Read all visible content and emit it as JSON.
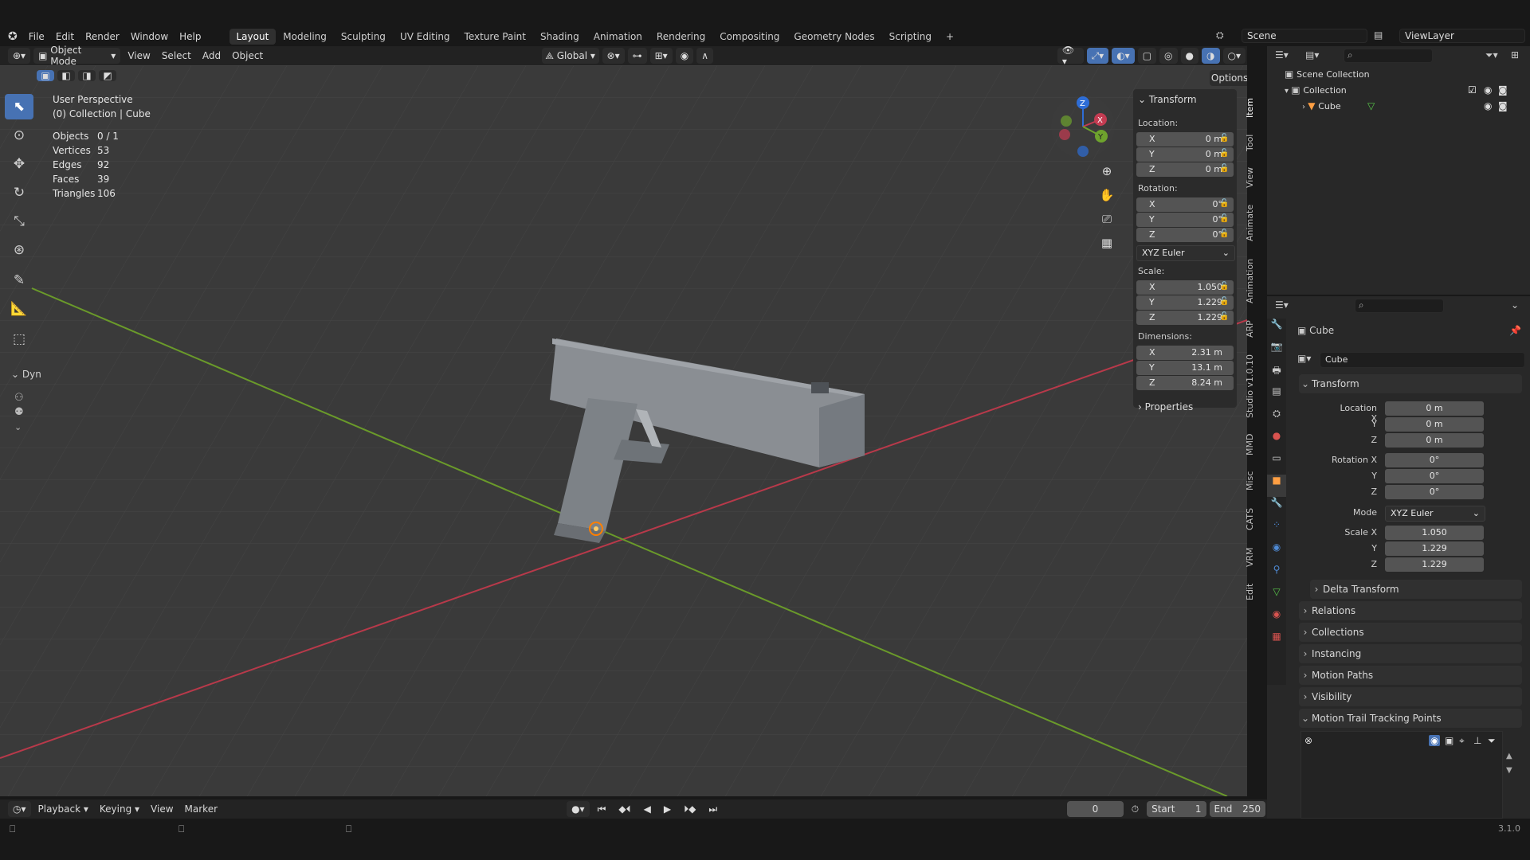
{
  "menus": {
    "file": "File",
    "edit": "Edit",
    "render": "Render",
    "window": "Window",
    "help": "Help"
  },
  "workspaces": [
    "Layout",
    "Modeling",
    "Sculpting",
    "UV Editing",
    "Texture Paint",
    "Shading",
    "Animation",
    "Rendering",
    "Compositing",
    "Geometry Nodes",
    "Scripting"
  ],
  "workspace_add": "+",
  "scene_name": "Scene",
  "view_layer": "ViewLayer",
  "viewport_header": {
    "mode": "Object Mode",
    "view": "View",
    "select": "Select",
    "add": "Add",
    "object": "Object",
    "orientation": "Global",
    "options": "Options"
  },
  "overlay": {
    "perspective": "User Perspective",
    "collection_line": "(0) Collection | Cube",
    "stats": [
      {
        "label": "Objects",
        "value": "0 / 1"
      },
      {
        "label": "Vertices",
        "value": "53"
      },
      {
        "label": "Edges",
        "value": "92"
      },
      {
        "label": "Faces",
        "value": "39"
      },
      {
        "label": "Triangles",
        "value": "106"
      }
    ],
    "dyn": "Dyn"
  },
  "npanel": {
    "title": "Transform",
    "location_label": "Location:",
    "location": [
      {
        "axis": "X",
        "value": "0 m"
      },
      {
        "axis": "Y",
        "value": "0 m"
      },
      {
        "axis": "Z",
        "value": "0 m"
      }
    ],
    "rotation_label": "Rotation:",
    "rotation": [
      {
        "axis": "X",
        "value": "0°"
      },
      {
        "axis": "Y",
        "value": "0°"
      },
      {
        "axis": "Z",
        "value": "0°"
      }
    ],
    "rotation_mode": "XYZ Euler",
    "scale_label": "Scale:",
    "scale": [
      {
        "axis": "X",
        "value": "1.050"
      },
      {
        "axis": "Y",
        "value": "1.229"
      },
      {
        "axis": "Z",
        "value": "1.229"
      }
    ],
    "dimensions_label": "Dimensions:",
    "dimensions": [
      {
        "axis": "X",
        "value": "2.31 m"
      },
      {
        "axis": "Y",
        "value": "13.1 m"
      },
      {
        "axis": "Z",
        "value": "8.24 m"
      }
    ],
    "properties": "Properties"
  },
  "side_tabs": [
    "Item",
    "Tool",
    "View",
    "Animate",
    "Animation",
    "ARP",
    "Studio v1.0.10",
    "MMD",
    "Misc",
    "CATS",
    "VRM",
    "Edit"
  ],
  "outliner": {
    "scene_collection": "Scene Collection",
    "collection": "Collection",
    "cube": "Cube"
  },
  "properties": {
    "object_name": "Cube",
    "object_field": "Cube",
    "transform_title": "Transform",
    "location_x_label": "Location X",
    "y_label": "Y",
    "z_label": "Z",
    "location": [
      "0 m",
      "0 m",
      "0 m"
    ],
    "rotation_x_label": "Rotation X",
    "rotation": [
      "0°",
      "0°",
      "0°"
    ],
    "mode_label": "Mode",
    "mode_value": "XYZ Euler",
    "scale_x_label": "Scale X",
    "scale": [
      "1.050",
      "1.229",
      "1.229"
    ],
    "delta_transform": "Delta Transform",
    "sections": [
      "Relations",
      "Collections",
      "Instancing",
      "Motion Paths",
      "Visibility"
    ],
    "motion_trail": "Motion Trail Tracking Points"
  },
  "timeline": {
    "playback": "Playback",
    "keying": "Keying",
    "view": "View",
    "marker": "Marker",
    "current_frame": "0",
    "start_label": "Start",
    "start": "1",
    "end_label": "End",
    "end": "250"
  },
  "version": "3.1.0",
  "colors": {
    "accent": "#4772b3",
    "x_axis": "#b8394a",
    "y_axis": "#6a9a2a",
    "viewport": "#3a3a3a"
  }
}
